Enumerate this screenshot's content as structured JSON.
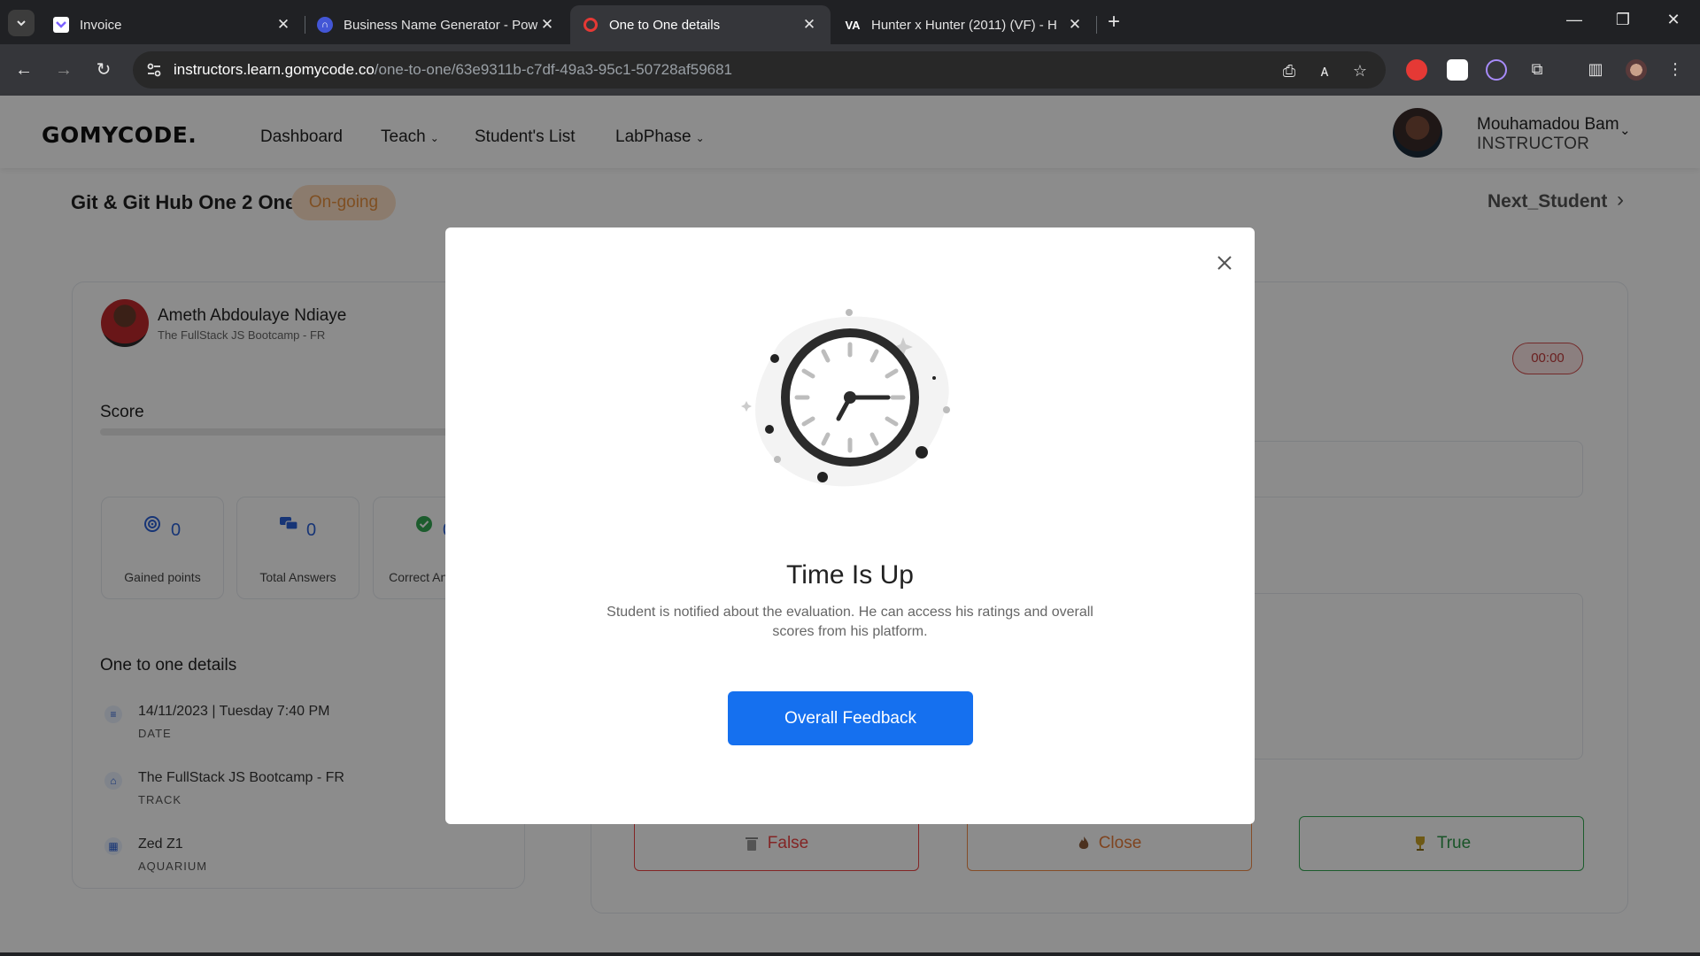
{
  "browser": {
    "tabs": [
      {
        "title": "Invoice",
        "active": false
      },
      {
        "title": "Business Name Generator - Pow",
        "active": false
      },
      {
        "title": "One to One details",
        "active": true
      },
      {
        "title": "Hunter x Hunter (2011) (VF) - H",
        "active": false
      }
    ],
    "url_host": "instructors.learn.gomycode.co",
    "url_path": "/one-to-one/63e9311b-c7df-49a3-95c1-50728af59681"
  },
  "header": {
    "logo": "GOMYCODE.",
    "nav": [
      "Dashboard",
      "Teach",
      "Student's List",
      "LabPhase"
    ],
    "user_name": "Mouhamadou Bam",
    "user_role": "INSTRUCTOR"
  },
  "session": {
    "title": "Git & Git Hub One 2 One",
    "status": "On-going",
    "next_label": "Next_Student"
  },
  "student": {
    "name": "Ameth Abdoulaye Ndiaye",
    "track": "The FullStack JS Bootcamp - FR",
    "score_label": "Score",
    "score_progress": 0
  },
  "stats": [
    {
      "value": "0",
      "label": "Gained points",
      "icon": "target-icon"
    },
    {
      "value": "0",
      "label": "Total Answers",
      "icon": "chat-icon"
    },
    {
      "value": "0",
      "label": "Correct Answers",
      "icon": "check-circle-icon"
    }
  ],
  "details": {
    "title": "One to one details",
    "rows": [
      {
        "main": "14/11/2023 | Tuesday 7:40 PM",
        "sub": "DATE",
        "icon": "list-icon"
      },
      {
        "main": "The FullStack JS Bootcamp - FR",
        "sub": "TRACK",
        "icon": "home-icon"
      },
      {
        "main": "Zed Z1",
        "sub": "AQUARIUM",
        "icon": "calendar-icon"
      }
    ]
  },
  "timer": "00:00",
  "answers": {
    "false_label": "False",
    "close_label": "Close",
    "true_label": "True"
  },
  "modal": {
    "title": "Time Is Up",
    "text": "Student is notified about the evaluation. He can access his ratings and overall scores from his platform.",
    "button": "Overall Feedback"
  }
}
